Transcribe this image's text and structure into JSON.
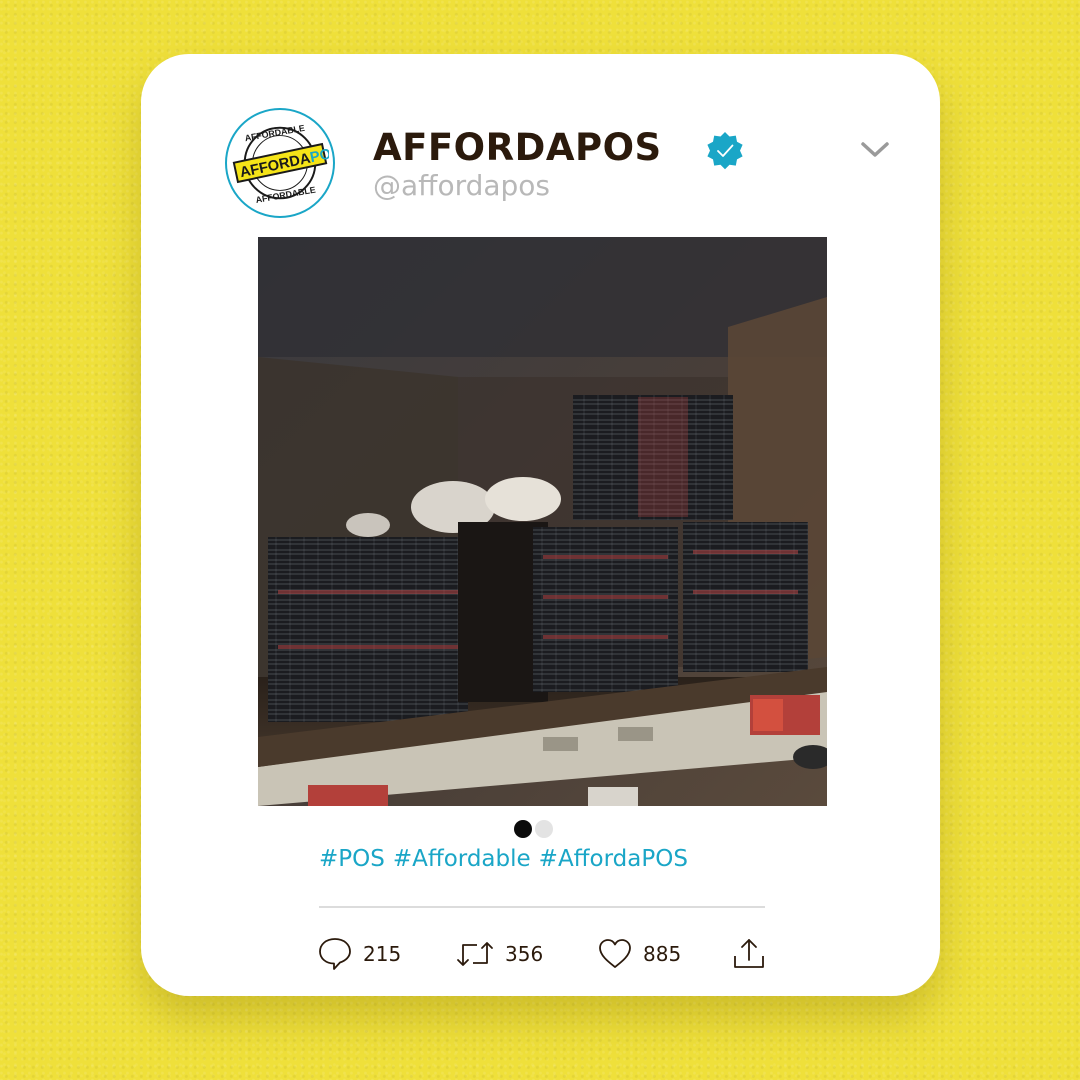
{
  "post": {
    "avatar": {
      "logo_text_top": "AFFORDABLE",
      "logo_text_main_a": "AFFORDA",
      "logo_text_main_b": "POS",
      "logo_text_bottom": "AFFORDABLE"
    },
    "display_name": "AFFORDAPOS",
    "handle": "@affordapos",
    "verified_icon": "verified-badge-icon",
    "menu_icon": "chevron-down-icon",
    "image_icon": "delivery-truck-photo",
    "carousel": {
      "total": 2,
      "active": 1
    },
    "hashtags": [
      "#POS",
      "#Affordable",
      "#AffordaPOS"
    ],
    "actions": {
      "comments": {
        "icon": "comment-icon",
        "count": "215"
      },
      "retweets": {
        "icon": "retweet-icon",
        "count": "356"
      },
      "likes": {
        "icon": "heart-icon",
        "count": "885"
      },
      "share": {
        "icon": "share-icon"
      }
    }
  },
  "colors": {
    "background": "#efe03a",
    "accent": "#1aa6c7",
    "name": "#2b1a0c",
    "handle": "#b8b8b8"
  }
}
